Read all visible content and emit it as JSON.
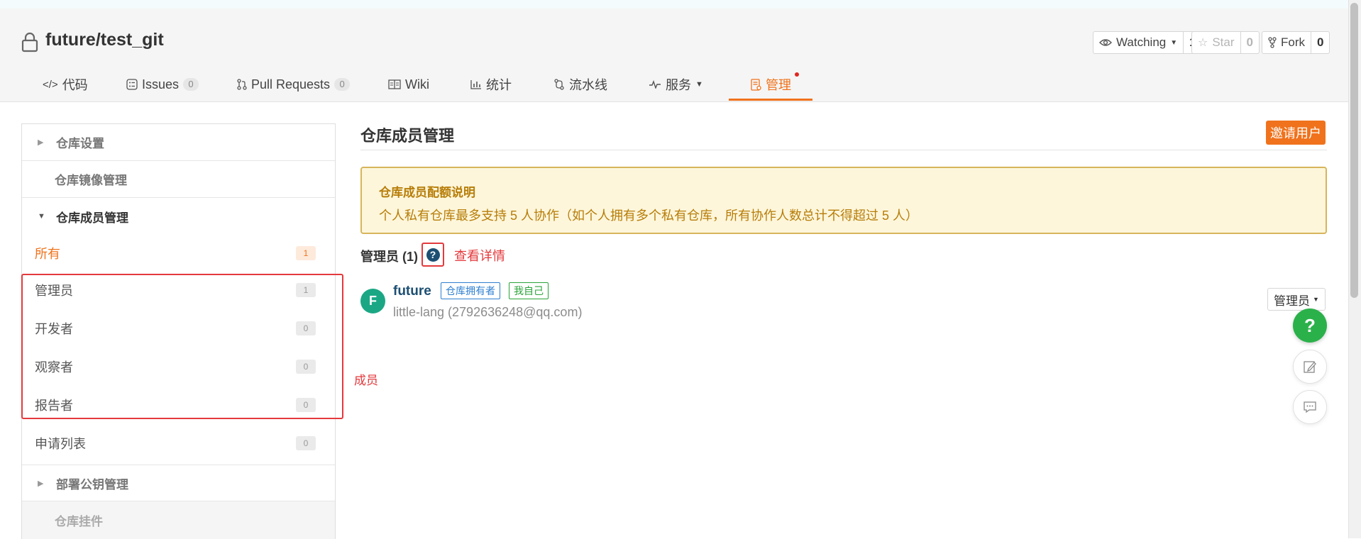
{
  "repo": {
    "title": "future/test_git",
    "icon": "lock-icon"
  },
  "header_buttons": {
    "watch": {
      "label": "Watching",
      "count": "1",
      "icon": "eye-icon"
    },
    "star": {
      "label": "Star",
      "count": "0",
      "icon": "star-icon"
    },
    "fork": {
      "label": "Fork",
      "count": "0",
      "icon": "fork-icon"
    }
  },
  "tabs": [
    {
      "label": "代码",
      "icon": "code-icon"
    },
    {
      "label": "Issues",
      "badge": "0",
      "icon": "issues-icon"
    },
    {
      "label": "Pull Requests",
      "badge": "0",
      "icon": "pull-request-icon"
    },
    {
      "label": "Wiki",
      "icon": "book-icon"
    },
    {
      "label": "统计",
      "icon": "bar-chart-icon"
    },
    {
      "label": "流水线",
      "icon": "pipeline-icon"
    },
    {
      "label": "服务",
      "icon": "pulse-icon"
    },
    {
      "label": "管理",
      "icon": "manage-icon",
      "active": true
    }
  ],
  "sidebar": {
    "repo_settings": "仓库设置",
    "mirror_mgmt": "仓库镜像管理",
    "member_mgmt": "仓库成员管理",
    "items": [
      {
        "label": "所有",
        "count": "1"
      },
      {
        "label": "管理员",
        "count": "1"
      },
      {
        "label": "开发者",
        "count": "0"
      },
      {
        "label": "观察者",
        "count": "0"
      },
      {
        "label": "报告者",
        "count": "0"
      },
      {
        "label": "申请列表",
        "count": "0"
      }
    ],
    "deploy_keys": "部署公钥管理",
    "widgets": "仓库挂件"
  },
  "annotations": {
    "members": "成员",
    "view_detail": "查看详情"
  },
  "main": {
    "title": "仓库成员管理",
    "invite_label": "邀请用户",
    "notice_title": "仓库成员配额说明",
    "notice_text": "个人私有仓库最多支持 5 人协作（如个人拥有多个私有仓库，所有协作人数总计不得超过 5 人）",
    "admin_label": "管理员 (1)",
    "member": {
      "avatar_letter": "F",
      "name": "future",
      "tag_owner": "仓库拥有者",
      "tag_self": "我自己",
      "sub": "little-lang (2792636248@qq.com)",
      "role": "管理员"
    }
  },
  "colors": {
    "accent": "#f0721c",
    "red": "#e4393c",
    "green": "#2bb14a",
    "link": "#1d4f73"
  }
}
